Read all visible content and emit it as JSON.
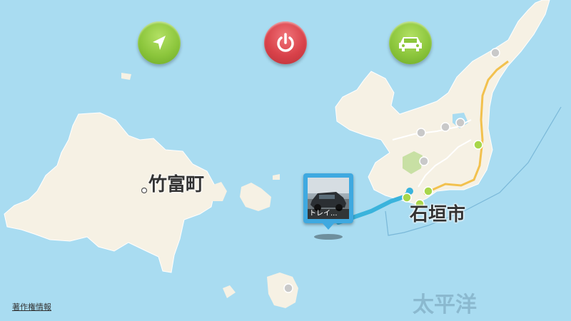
{
  "toolbar": {
    "locate_icon": "navigation-arrow-icon",
    "power_icon": "power-icon",
    "car_icon": "car-icon",
    "colors": {
      "green": "#8cc63c",
      "red": "#d9424a"
    }
  },
  "map": {
    "labels": {
      "taketomi": "竹富町",
      "ishigaki": "石垣市",
      "pacific": "太平洋"
    },
    "copyright": "著作権情報",
    "photo_pin": {
      "caption": "トレイ..."
    },
    "colors": {
      "water": "#a9dcf1",
      "land": "#f6f1e4",
      "route": "#3ab3dc",
      "road": "#f2c14e"
    }
  }
}
